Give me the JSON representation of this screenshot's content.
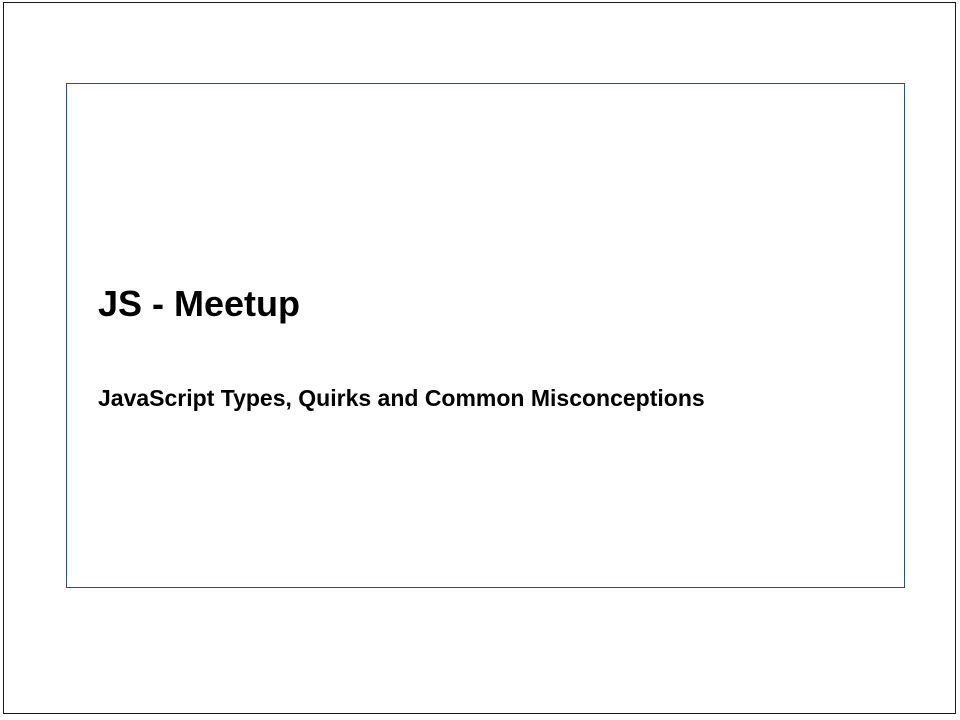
{
  "slide": {
    "title": "JS - Meetup",
    "subtitle": "JavaScript Types, Quirks and Common Misconceptions"
  },
  "colors": {
    "frame_border": "#1a1a1a",
    "panel_border": "#2f4f7a",
    "text": "#000000",
    "background": "#ffffff"
  }
}
